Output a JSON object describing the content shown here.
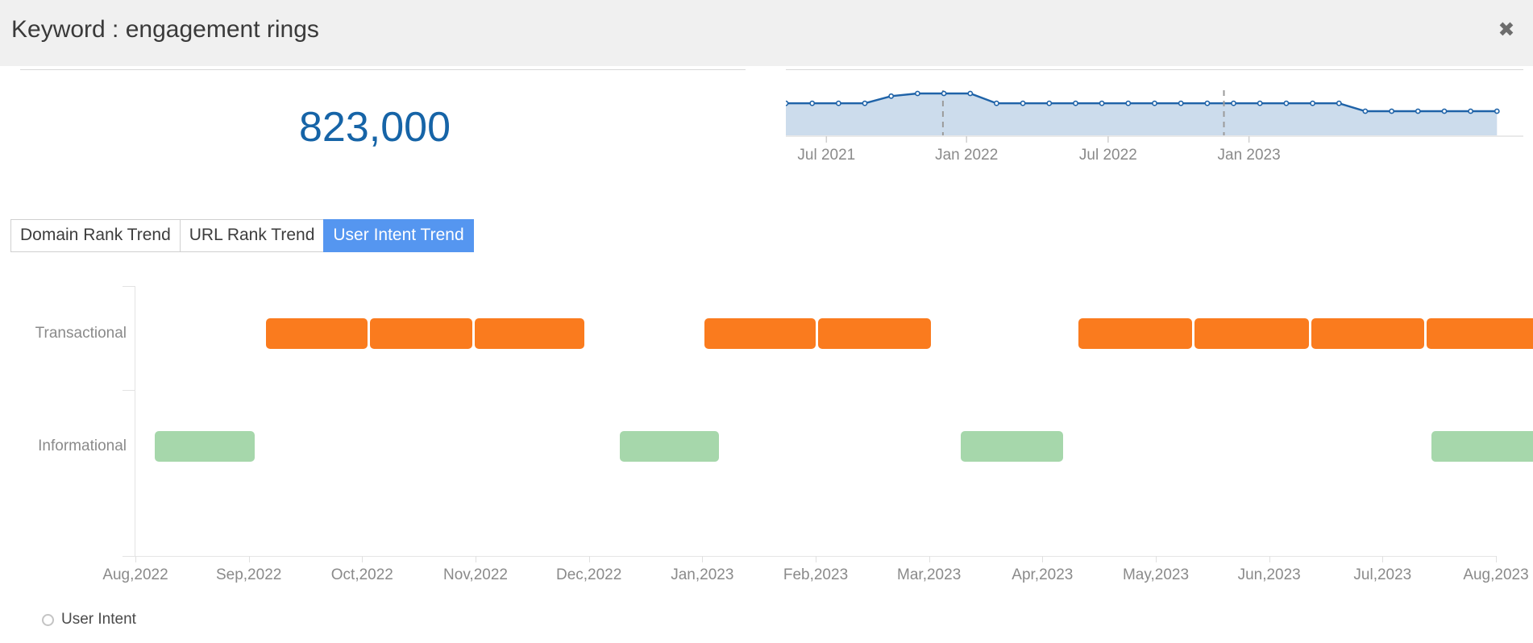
{
  "header": {
    "title": "Keyword : engagement rings",
    "close_label": "✖"
  },
  "metrics": {
    "search_volume": "823,000"
  },
  "tabs": [
    {
      "label": "Domain Rank Trend",
      "active": false
    },
    {
      "label": "URL Rank Trend",
      "active": false
    },
    {
      "label": "User Intent Trend",
      "active": true
    }
  ],
  "legend": [
    {
      "label": "User Intent",
      "marker_color": "#c4c4c4"
    }
  ],
  "colors": {
    "volume_blue": "#1664a7",
    "tab_active_blue": "#5596f0",
    "transactional_orange": "#fa7b1e",
    "informational_green": "#a6d7ab",
    "sparkline_line": "#1f63a8",
    "sparkline_fill": "#ccdcec",
    "header_bg": "#f0f0f0"
  },
  "chart_data": [
    {
      "type": "area",
      "name": "search-volume-sparkline",
      "title": "",
      "xlabel": "",
      "ylabel": "",
      "grid": false,
      "legend": "none",
      "tick_labels": [
        "Jul 2021",
        "Jan 2022",
        "Jul 2022",
        "Jan 2023"
      ],
      "tick_positions": [
        0.055,
        0.245,
        0.437,
        0.628
      ],
      "markers": true,
      "annotations": [
        {
          "type": "vertical-dashed",
          "position": 0.213
        },
        {
          "type": "vertical-dashed",
          "position": 0.594
        }
      ],
      "x": [
        "Apr 2021",
        "May 2021",
        "Jun 2021",
        "Jul 2021",
        "Aug 2021",
        "Sep 2021",
        "Oct 2021",
        "Nov 2021",
        "Dec 2021",
        "Jan 2022",
        "Feb 2022",
        "Mar 2022",
        "Apr 2022",
        "May 2022",
        "Jun 2022",
        "Jul 2022",
        "Aug 2022",
        "Sep 2022",
        "Oct 2022",
        "Nov 2022",
        "Dec 2022",
        "Jan 2023",
        "Feb 2023",
        "Mar 2023",
        "Apr 2023",
        "May 2023",
        "Jun 2023",
        "Jul 2023"
      ],
      "values": [
        823000,
        823000,
        823000,
        823000,
        880000,
        901000,
        901000,
        901000,
        823000,
        823000,
        823000,
        823000,
        823000,
        823000,
        823000,
        823000,
        823000,
        823000,
        823000,
        823000,
        823000,
        823000,
        760000,
        760000,
        760000,
        760000,
        760000,
        760000
      ],
      "ylim": [
        0,
        1000000
      ]
    },
    {
      "type": "bar",
      "name": "user-intent-trend",
      "orientation": "horizontal-timeline",
      "title": "",
      "xlabel": "",
      "ylabel": "",
      "grid": false,
      "legend": "bottom-left",
      "categories": [
        "Transactional",
        "Informational"
      ],
      "x_tick_labels": [
        "Aug,2022",
        "Sep,2022",
        "Oct,2022",
        "Nov,2022",
        "Dec,2022",
        "Jan,2023",
        "Feb,2023",
        "Mar,2023",
        "Apr,2023",
        "May,2023",
        "Jun,2023",
        "Jul,2023",
        "Aug,2023"
      ],
      "bars": [
        {
          "category": "Transactional",
          "color": "#fa7b1e",
          "start": 1.15,
          "end": 2.05
        },
        {
          "category": "Transactional",
          "color": "#fa7b1e",
          "start": 2.07,
          "end": 2.97
        },
        {
          "category": "Transactional",
          "color": "#fa7b1e",
          "start": 2.99,
          "end": 3.96
        },
        {
          "category": "Transactional",
          "color": "#fa7b1e",
          "start": 5.02,
          "end": 6.0
        },
        {
          "category": "Transactional",
          "color": "#fa7b1e",
          "start": 6.02,
          "end": 7.02
        },
        {
          "category": "Transactional",
          "color": "#fa7b1e",
          "start": 8.32,
          "end": 9.32
        },
        {
          "category": "Transactional",
          "color": "#fa7b1e",
          "start": 9.34,
          "end": 10.35
        },
        {
          "category": "Transactional",
          "color": "#fa7b1e",
          "start": 10.37,
          "end": 11.37
        },
        {
          "category": "Transactional",
          "color": "#fa7b1e",
          "start": 11.39,
          "end": 12.4
        },
        {
          "category": "Informational",
          "color": "#a6d7ab",
          "start": 0.17,
          "end": 1.05
        },
        {
          "category": "Informational",
          "color": "#a6d7ab",
          "start": 4.27,
          "end": 5.15
        },
        {
          "category": "Informational",
          "color": "#a6d7ab",
          "start": 7.28,
          "end": 8.18
        },
        {
          "category": "Informational",
          "color": "#a6d7ab",
          "start": 11.43,
          "end": 12.4
        }
      ]
    }
  ]
}
